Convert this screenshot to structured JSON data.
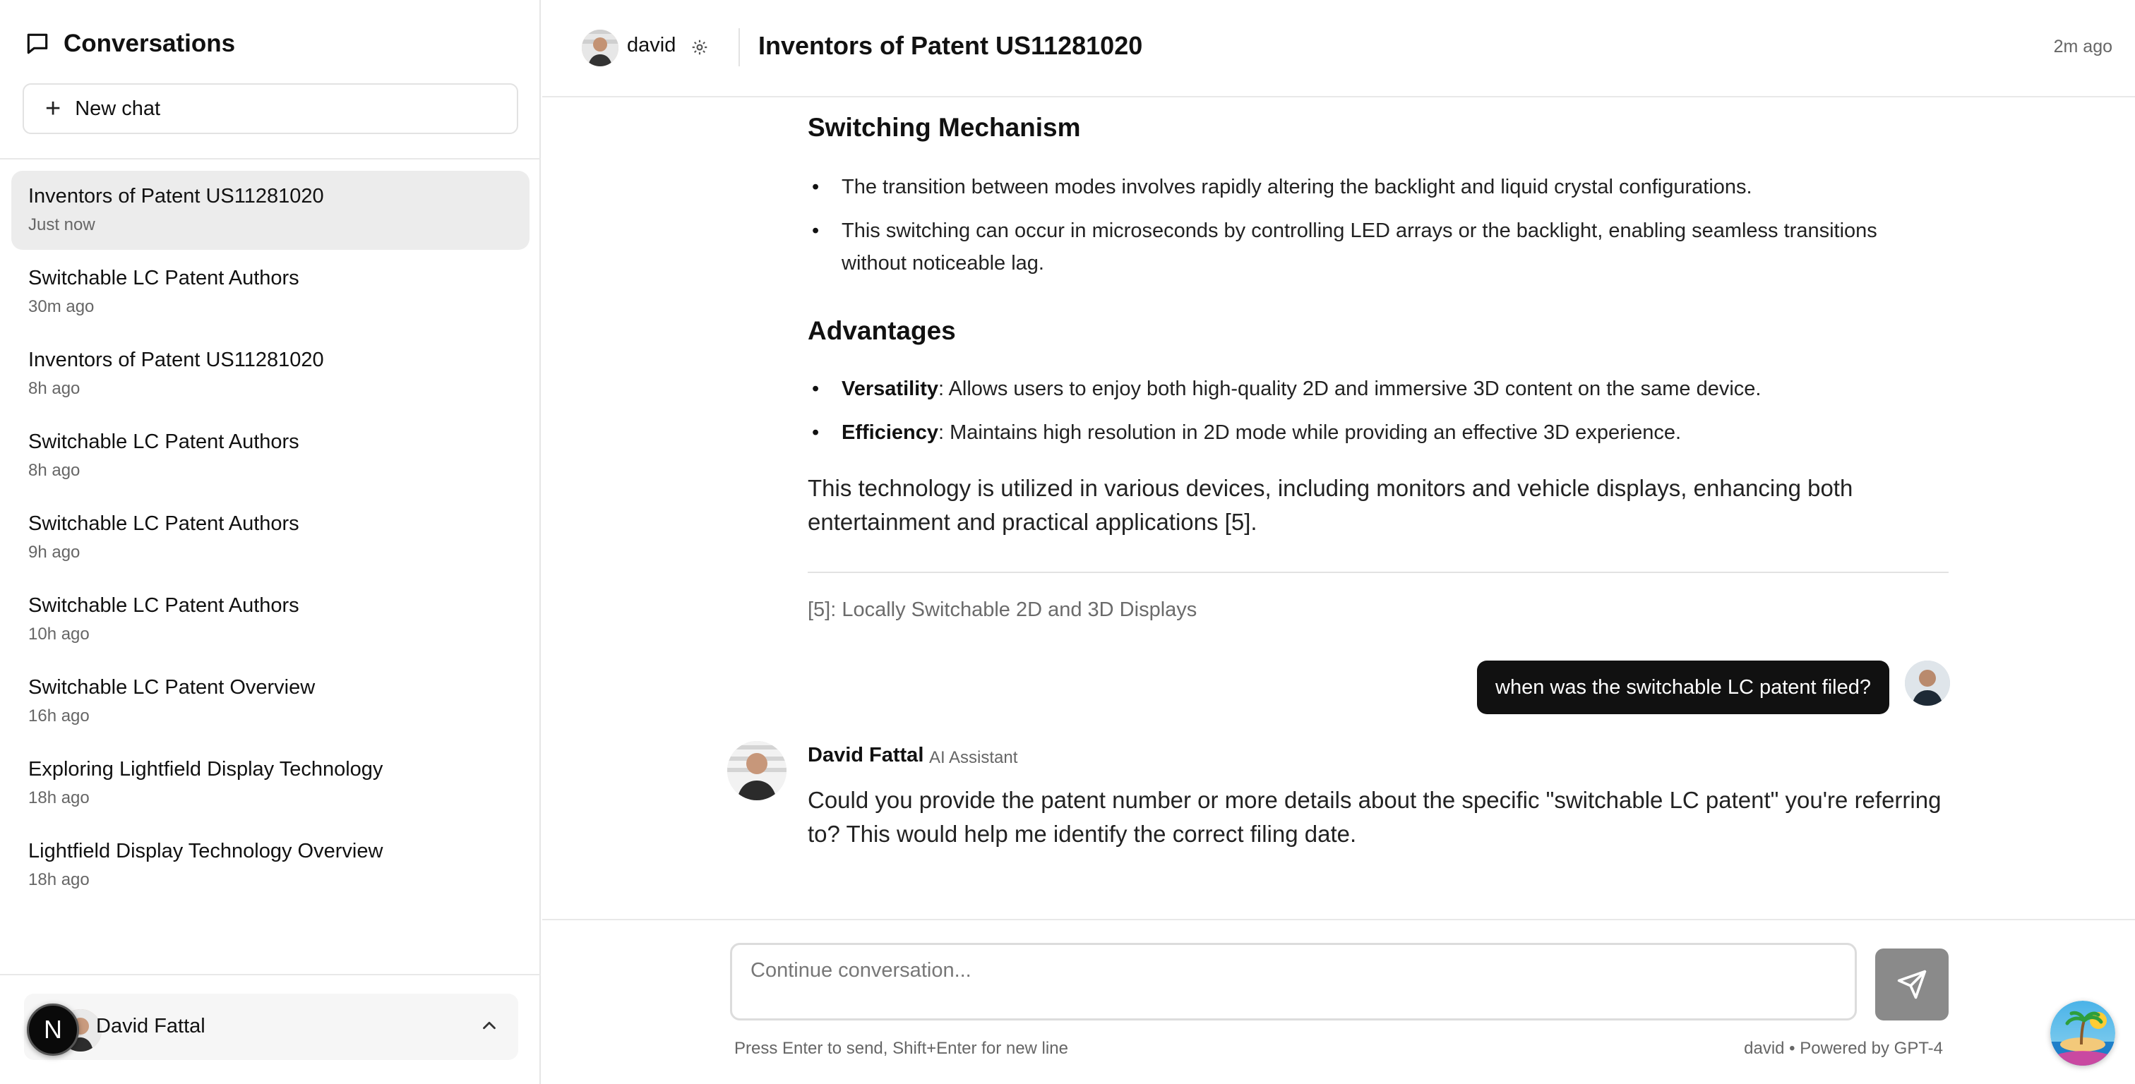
{
  "sidebar": {
    "title": "Conversations",
    "new_chat_label": "New chat",
    "conversations": [
      {
        "title": "Inventors of Patent US11281020",
        "time": "Just now"
      },
      {
        "title": "Switchable LC Patent Authors",
        "time": "30m ago"
      },
      {
        "title": "Inventors of Patent US11281020",
        "time": "8h ago"
      },
      {
        "title": "Switchable LC Patent Authors",
        "time": "8h ago"
      },
      {
        "title": "Switchable LC Patent Authors",
        "time": "9h ago"
      },
      {
        "title": "Switchable LC Patent Authors",
        "time": "10h ago"
      },
      {
        "title": "Switchable LC Patent Overview",
        "time": "16h ago"
      },
      {
        "title": "Exploring Lightfield Display Technology",
        "time": "18h ago"
      },
      {
        "title": "Lightfield Display Technology Overview",
        "time": "18h ago"
      }
    ],
    "user": {
      "badge": "N",
      "name": "David Fattal"
    }
  },
  "header": {
    "username": "david",
    "title": "Inventors of Patent US11281020",
    "time": "2m ago"
  },
  "message": {
    "section1_title": "Switching Mechanism",
    "section1_bullets": [
      "The transition between modes involves rapidly altering the backlight and liquid crystal configurations.",
      "This switching can occur in microseconds by controlling LED arrays or the backlight, enabling seamless transitions without noticeable lag."
    ],
    "section2_title": "Advantages",
    "section2_bullets": [
      {
        "term": "Versatility",
        "text": ": Allows users to enjoy both high-quality 2D and immersive 3D content on the same device."
      },
      {
        "term": "Efficiency",
        "text": ": Maintains high resolution in 2D mode while providing an effective 3D experience."
      }
    ],
    "paragraph": "This technology is utilized in various devices, including monitors and vehicle displays, enhancing both entertainment and practical applications [5].",
    "footnote": "[5]: Locally Switchable 2D and 3D Displays"
  },
  "user_message": "when was the switchable LC patent filed?",
  "assistant": {
    "name": "David Fattal",
    "role": "AI Assistant",
    "text": "Could you provide the patent number or more details about the specific \"switchable LC patent\" you're referring to? This would help me identify the correct filing date."
  },
  "composer": {
    "placeholder": "Continue conversation...",
    "hint": "Press Enter to send, Shift+Enter for new line",
    "powered": "david • Powered by GPT-4"
  },
  "colors": {
    "accent_dark": "#111111",
    "send_button": "#8a8a8a",
    "active_item": "#ececec"
  }
}
